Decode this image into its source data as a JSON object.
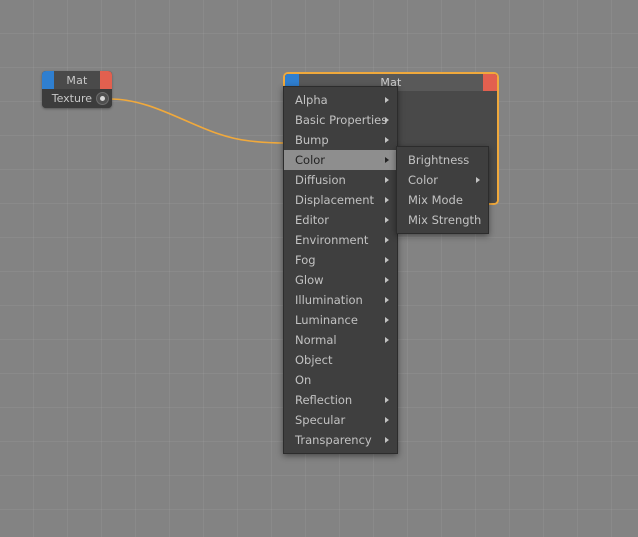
{
  "app": {
    "background_color": "#838383",
    "grid_color": "#8d8d8d",
    "accent_color": "#f0a93c"
  },
  "nodes": [
    {
      "id": "node-texture",
      "title": "Mat",
      "rows": [
        {
          "label": "Texture",
          "port": "circle-port-icon"
        }
      ],
      "left_port_color": "#2f7fd0",
      "right_port_color": "#e2604f",
      "selected": false
    },
    {
      "id": "node-mat",
      "title": "Mat",
      "left_port_color": "#2f7fd0",
      "right_port_color": "#e2604f",
      "selected": true,
      "selection_color": "#f0a93c"
    }
  ],
  "connection": {
    "color": "#f0a93c",
    "from": "node-texture.Texture",
    "to": "node-mat"
  },
  "menu": {
    "highlighted": "Color",
    "items": [
      {
        "label": "Alpha",
        "submenu": true
      },
      {
        "label": "Basic Properties",
        "submenu": true
      },
      {
        "label": "Bump",
        "submenu": true
      },
      {
        "label": "Color",
        "submenu": true
      },
      {
        "label": "Diffusion",
        "submenu": true
      },
      {
        "label": "Displacement",
        "submenu": true
      },
      {
        "label": "Editor",
        "submenu": true
      },
      {
        "label": "Environment",
        "submenu": true
      },
      {
        "label": "Fog",
        "submenu": true
      },
      {
        "label": "Glow",
        "submenu": true
      },
      {
        "label": "Illumination",
        "submenu": true
      },
      {
        "label": "Luminance",
        "submenu": true
      },
      {
        "label": "Normal",
        "submenu": true
      },
      {
        "label": "Object",
        "submenu": false
      },
      {
        "label": "On",
        "submenu": false
      },
      {
        "label": "Reflection",
        "submenu": true
      },
      {
        "label": "Specular",
        "submenu": true
      },
      {
        "label": "Transparency",
        "submenu": true
      }
    ]
  },
  "submenu": {
    "parent": "Color",
    "items": [
      {
        "label": "Brightness",
        "submenu": false
      },
      {
        "label": "Color",
        "submenu": true
      },
      {
        "label": "Mix Mode",
        "submenu": false
      },
      {
        "label": "Mix Strength",
        "submenu": false
      }
    ]
  }
}
